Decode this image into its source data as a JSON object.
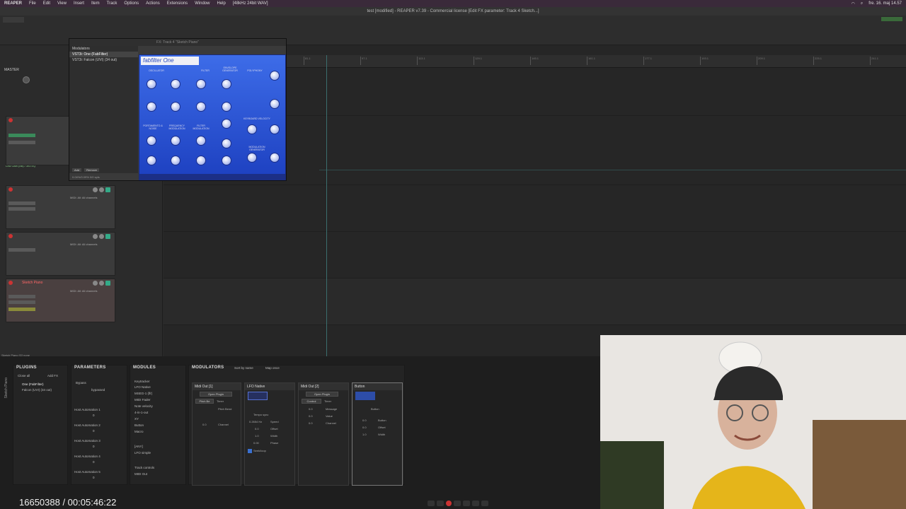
{
  "menubar": {
    "app": "REAPER",
    "items": [
      "File",
      "Edit",
      "View",
      "Insert",
      "Item",
      "Track",
      "Options",
      "Actions",
      "Extensions",
      "Window",
      "Help",
      "[48kHz 24bit WAV]"
    ],
    "clock": "fre. 16. maj 14.57"
  },
  "window_title": "test [modified] - REAPER v7.39 - Commercial license [Edit FX parameter: Track 4 Sketch...]",
  "fx_window": {
    "title": "FX: Track 4 \"Sketch Piano\"",
    "list": [
      "Modulators",
      "VST3i: One (FabFilter)",
      "VST3i: Falcon (UVI) (34 out)"
    ],
    "add": "Add",
    "remove": "Remove",
    "cpu": "0.04%/0.09% 0/0 spls",
    "plugin_logo": "fabfilter One",
    "sections": [
      "OSCILLATOR",
      "FILTER",
      "ENVELOPE GENERATOR",
      "POLYPHONY",
      "PORTAMENTO & NOISE",
      "FREQUENCY MODULATION",
      "FILTER MODULATION",
      "KEYBOARD VELOCITY",
      "MODULATION GENERATOR"
    ],
    "knob_labels": [
      "SCALE",
      "WAVE FORM",
      "FREQUENCY",
      "HOLD",
      "VOLUME",
      "PITCH",
      "PW / PWM",
      "PEAK",
      "ATTACK",
      "PORTAMENTO",
      "DECAY",
      "VOLUME",
      "FILTER",
      "NOISE",
      "SUSTAIN",
      "RELEASE",
      "FREQUENCY",
      "WAVE FORM"
    ]
  },
  "tracks": [
    {
      "name": "",
      "midi": "MIDI: All: All channels"
    },
    {
      "name": "",
      "midi": "MIDI: All: All channels"
    },
    {
      "name": "",
      "midi": "MIDI: All: All channels"
    },
    {
      "name": "Sketch Piano",
      "midi": "MIDI: All: All channels"
    }
  ],
  "master_label": "MASTER",
  "low_gain": "Low Gain (dB) / 3x3 EQ",
  "ruler_marks": [
    "81.1",
    "97.1",
    "113.1",
    "129.1",
    "145.1",
    "161.1",
    "177.1",
    "193.1",
    "209.1",
    "225.1",
    "241.1"
  ],
  "status_line": "Sketch Piano [G] none",
  "bottom": {
    "plugins": {
      "title": "PLUGINS",
      "close_all": "Close all",
      "add_fx": "Add FX",
      "items": [
        "One (FabFilter)",
        "Falcon (UVI) (34 out)"
      ]
    },
    "parameters": {
      "title": "PARAMETERS",
      "bypass": "Bypass",
      "bypassed": "bypassed",
      "hosts": [
        "Host Automation 1",
        "Host Automation 2",
        "Host Automation 3",
        "Host Automation 4",
        "Host Automation 5"
      ],
      "values": [
        "0",
        "0",
        "0",
        "0",
        "0"
      ]
    },
    "modules": {
      "title": "MODULES",
      "items": [
        "Keytracker",
        "LFO Native",
        "MSEG-1 (lfr)",
        "MIDI Fader",
        "Note velocity",
        "4-in-1-out",
        "XY",
        "Button",
        "Macro",
        "[ANY]",
        "LFO simple",
        "Track controls",
        "MIDI Out"
      ]
    },
    "modulators": {
      "title": "MODULATORS",
      "sort": "Sort by name",
      "map": "Map once"
    },
    "mod1": {
      "title": "Midi Out [1]",
      "open": "Open Plugin",
      "pitch": "Pitch Be",
      "timer": "Timer",
      "rows": [
        "Pitch Bend",
        "Channel"
      ],
      "vals": [
        "0.0"
      ]
    },
    "mod2": {
      "title": "LFO Native",
      "tempo": "Tempo sync",
      "rows": [
        "Speed",
        "Offset",
        "Width",
        "Phase"
      ],
      "vals": [
        "0.2654 Hz",
        "0.0",
        "1.0",
        "0.00"
      ],
      "seek": "Seek/loop"
    },
    "mod3": {
      "title": "Midi Out [2]",
      "open": "Open Plugin",
      "ctrl": "Control",
      "timer": "Timer",
      "rows": [
        "Message",
        "Value",
        "Channel"
      ],
      "vals": [
        "0.0",
        "0.0",
        "0.0"
      ]
    },
    "mod4": {
      "title": "Button",
      "btn": "Button",
      "rows": [
        "Button",
        "Offset",
        "Width"
      ],
      "vals": [
        "0.0",
        "0.0",
        "1.0"
      ]
    }
  },
  "counter": "16650388 / 00:05:46:22",
  "sidebar_vertical": "Sketch Piano"
}
